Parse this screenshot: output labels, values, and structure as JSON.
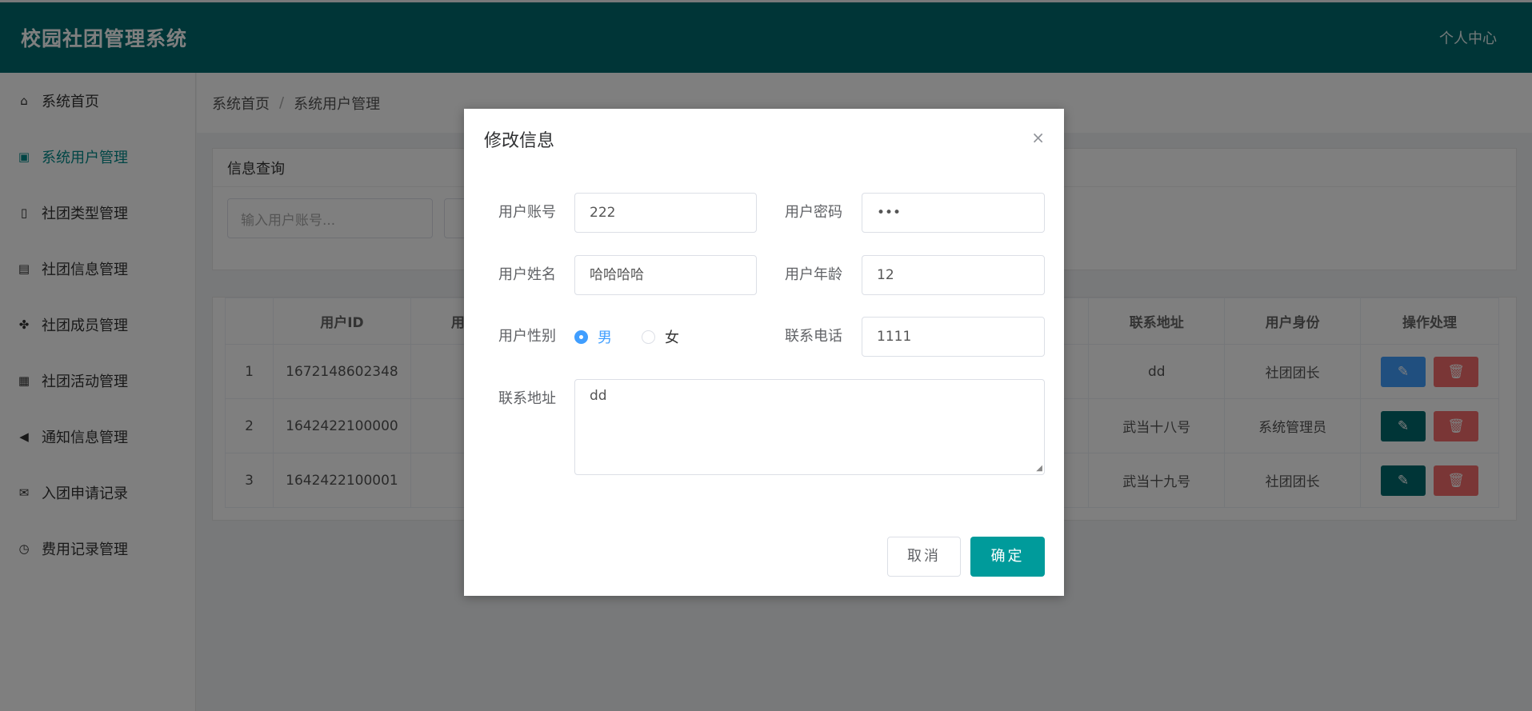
{
  "header": {
    "title": "校园社团管理系统",
    "user_center": "个人中心"
  },
  "sidebar": {
    "items": [
      {
        "label": "系统首页",
        "icon": "home-icon",
        "glyph": "⌂"
      },
      {
        "label": "系统用户管理",
        "icon": "user-card-icon",
        "glyph": "▣"
      },
      {
        "label": "社团类型管理",
        "icon": "tablet-icon",
        "glyph": "▯"
      },
      {
        "label": "社团信息管理",
        "icon": "train-icon",
        "glyph": "▤"
      },
      {
        "label": "社团成员管理",
        "icon": "cubes-icon",
        "glyph": "✤"
      },
      {
        "label": "社团活动管理",
        "icon": "calculator-icon",
        "glyph": "▦"
      },
      {
        "label": "通知信息管理",
        "icon": "bullhorn-icon",
        "glyph": "◀"
      },
      {
        "label": "入团申请记录",
        "icon": "envelope-open-icon",
        "glyph": "✉"
      },
      {
        "label": "费用记录管理",
        "icon": "clock-icon",
        "glyph": "◷"
      }
    ]
  },
  "breadcrumb": {
    "home": "系统首页",
    "sep": "/",
    "current": "系统用户管理"
  },
  "query": {
    "title": "信息查询",
    "account_placeholder": "输入用户账号..."
  },
  "table": {
    "headers": [
      "",
      "用户ID",
      "用",
      "联系地址",
      "用户身份",
      "操作处理"
    ],
    "rows": [
      {
        "index": "1",
        "id": "1672148602348",
        "name": "",
        "address": "dd",
        "role": "社团团长"
      },
      {
        "index": "2",
        "id": "1642422100000",
        "name": "",
        "address": "武当十八号",
        "role": "系统管理员"
      },
      {
        "index": "3",
        "id": "1642422100001",
        "name": "",
        "address": "武当十九号",
        "role": "社团团长"
      }
    ],
    "edit_glyph": "✎",
    "delete_glyph": "🗑"
  },
  "dialog": {
    "title": "修改信息",
    "close_glyph": "×",
    "account_label": "用户账号",
    "account_value": "222",
    "password_label": "用户密码",
    "password_value": "•••",
    "name_label": "用户姓名",
    "name_value": "哈哈哈哈",
    "age_label": "用户年龄",
    "age_value": "12",
    "gender_label": "用户性别",
    "gender_male": "男",
    "gender_female": "女",
    "phone_label": "联系电话",
    "phone_value": "1111",
    "address_label": "联系地址",
    "address_value": "dd",
    "cancel_label": "取消",
    "ok_label": "确定"
  },
  "colors": {
    "header_bg": "#006a6e",
    "active": "#008b8b",
    "primary": "#009b9b",
    "danger": "#f56c6c",
    "radio": "#409eff"
  }
}
